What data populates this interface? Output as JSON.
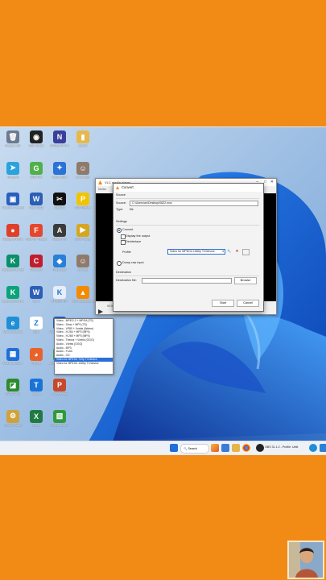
{
  "desktop": {
    "icons": [
      {
        "label": "Recycle Bin",
        "color": "#6b7a8f",
        "glyph": "🗑"
      },
      {
        "label": "OBS Studio",
        "color": "#222222",
        "glyph": "◉"
      },
      {
        "label": "NTRES PHP 8",
        "color": "#3a3f9a",
        "glyph": "N"
      },
      {
        "label": "edutoff",
        "color": "#e7b84a",
        "glyph": "▮"
      },
      {
        "label": "Telegram",
        "color": "#2aa3dc",
        "glyph": "➤"
      },
      {
        "label": "GDS Win",
        "color": "#52b04a",
        "glyph": "G"
      },
      {
        "label": "Sakura Ball",
        "color": "#2a72d6",
        "glyph": "✦"
      },
      {
        "label": "anhdungvtr",
        "color": "#8f7b6b",
        "glyph": "☺"
      },
      {
        "label": "Windows Defender",
        "color": "#2a5fbf",
        "glyph": "▣"
      },
      {
        "label": "Word 2016",
        "color": "#2b5fb6",
        "glyph": "W"
      },
      {
        "label": "CapCut",
        "color": "#111111",
        "glyph": "✂"
      },
      {
        "label": "PDF Reader",
        "color": "#f2c400",
        "glyph": "P"
      },
      {
        "label": "Google Chrome",
        "color": "#e0402a",
        "glyph": "●"
      },
      {
        "label": "FoxitPDF Reader",
        "color": "#e5472d",
        "glyph": "F"
      },
      {
        "label": "Adobe Pro",
        "color": "#3a3a3a",
        "glyph": "A"
      },
      {
        "label": "GOM Player",
        "color": "#d7a61f",
        "glyph": "▶"
      },
      {
        "label": "Kaspersky Endpoint",
        "color": "#0a8f6a",
        "glyph": "K"
      },
      {
        "label": "Cisco ent",
        "color": "#c01e2e",
        "glyph": "C"
      },
      {
        "label": "PeeRouter",
        "color": "#2a7fd6",
        "glyph": "◆"
      },
      {
        "label": "sinhvien",
        "color": "#8f7b6b",
        "glyph": "☺"
      },
      {
        "label": "Kaspersky Internet",
        "color": "#0ca37a",
        "glyph": "K"
      },
      {
        "label": "Word",
        "color": "#2b5fb6",
        "glyph": "W"
      },
      {
        "label": "NTRES PHP",
        "color": "#e8eef7",
        "glyph": "K"
      },
      {
        "label": "VLC media player",
        "color": "#f48a00",
        "glyph": "▲"
      },
      {
        "label": "Microsoft Edge",
        "color": "#1f8fd6",
        "glyph": "e"
      },
      {
        "label": "Zalo",
        "color": "#ffffff",
        "glyph": "Z"
      },
      {
        "label": "Word document",
        "color": "#2b5fb6",
        "glyph": "W"
      },
      {
        "label": "",
        "color": "transparent",
        "glyph": ""
      },
      {
        "label": "Microsoft Store",
        "color": "#1f6fd6",
        "glyph": "▦"
      },
      {
        "label": "Firefox",
        "color": "#e8622a",
        "glyph": "◕"
      },
      {
        "label": "BlueStacks Multi Instance",
        "color": "#38a84a",
        "glyph": "▤"
      },
      {
        "label": "",
        "color": "transparent",
        "glyph": ""
      },
      {
        "label": "NVIDIA App",
        "color": "#2d8a2d",
        "glyph": "◪"
      },
      {
        "label": "Unikey",
        "color": "#1a73d6",
        "glyph": "T"
      },
      {
        "label": "PowerPoint",
        "color": "#c8482a",
        "glyph": "P"
      },
      {
        "label": "",
        "color": "transparent",
        "glyph": ""
      },
      {
        "label": "Control Panel",
        "color": "#cfa23a",
        "glyph": "⚙"
      },
      {
        "label": "Excel",
        "color": "#1f7a43",
        "glyph": "X"
      },
      {
        "label": "BlueStacks 5",
        "color": "#2f9a3a",
        "glyph": "▧"
      }
    ]
  },
  "vlc": {
    "title": "VLC media player",
    "menu": "Media",
    "time": "00:00"
  },
  "dialog": {
    "title": "Convert",
    "source_heading": "Source",
    "source_label": "Source:",
    "source_value": "C:\\Users\\an\\Desktop\\0822.mov",
    "type_label": "Type:",
    "type_value": "file",
    "settings_heading": "Settings",
    "convert_label": "Convert",
    "display_output_label": "Display the output",
    "deinterlace_label": "Deinterlace",
    "profile_label": "Profile",
    "profile_selected": "Video for MPEG4 1080p TV/device",
    "dump_raw_label": "Dump raw input",
    "destination_heading": "Destination",
    "destination_file_label": "Destination file:",
    "browse_label": "Browse",
    "start_label": "Start",
    "cancel_label": "Cancel"
  },
  "profile_options": [
    "Video - MPEG-2 + MPGA (TS)",
    "Video - Dirac + MP3 (TS)",
    "Video - VP80 + Vorbis (Webm)",
    "Video - H.264 + MP3 (MP4)",
    "Video - H.265 + MP3 (MP4)",
    "Video - Theora + Vorbis (OGG)",
    "Audio - Vorbis (OGG)",
    "Audio - MP3",
    "Audio - FLAC",
    "Audio - CD",
    "Video for MPEG4 720p TV/device",
    "Video for MPEG4 1080p TV/device"
  ],
  "profile_selected_index": 10,
  "taskbar": {
    "search_label": "Search",
    "obs_label": "OBS 31.1.2 - Profile: Untit"
  }
}
